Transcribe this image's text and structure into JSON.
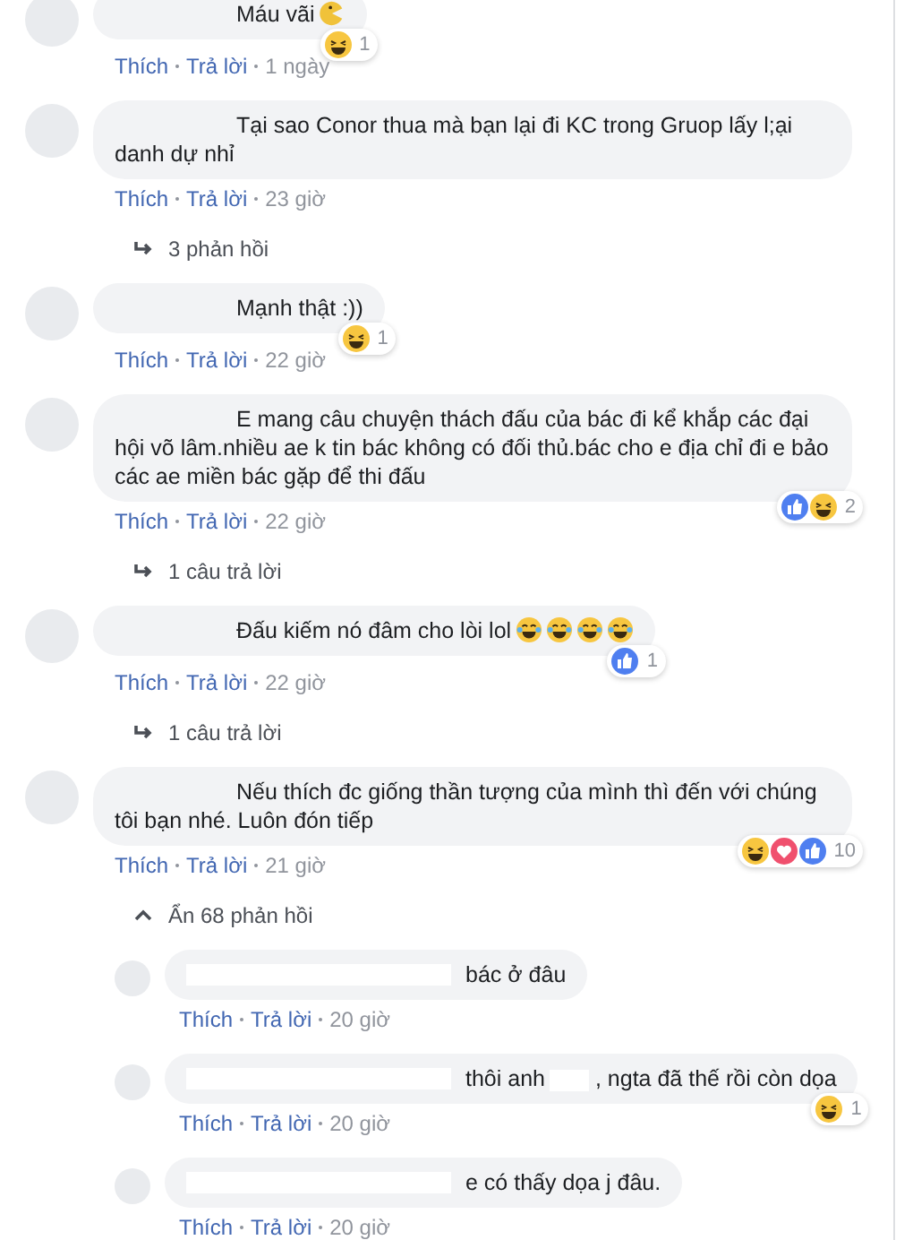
{
  "comments": [
    {
      "text": "Máu vãi",
      "emoji": [
        {
          "kind": "pacman"
        }
      ],
      "reactions": [
        {
          "kind": "haha"
        }
      ],
      "reaction_count": "1",
      "like_label": "Thích",
      "reply_label": "Trả lời",
      "time": "1 ngày"
    },
    {
      "text": "Tại sao Conor thua mà bạn lại đi KC trong Gruop lấy l;ại danh dự nhỉ",
      "like_label": "Thích",
      "reply_label": "Trả lời",
      "time": "23 giờ",
      "thread": {
        "kind": "collapsed",
        "label": "3 phản hồi"
      }
    },
    {
      "text": "Mạnh thật :))",
      "reactions": [
        {
          "kind": "haha"
        }
      ],
      "reaction_count": "1",
      "like_label": "Thích",
      "reply_label": "Trả lời",
      "time": "22 giờ"
    },
    {
      "text": "E mang câu chuyện thách đấu của bác đi kể khắp các đại hội võ lâm.nhiều ae k tin bác không có đối thủ.bác cho e địa chỉ đi e bảo các ae miền bác gặp để thi đấu",
      "reactions": [
        {
          "kind": "like"
        },
        {
          "kind": "haha"
        }
      ],
      "reaction_count": "2",
      "like_label": "Thích",
      "reply_label": "Trả lời",
      "time": "22 giờ",
      "thread": {
        "kind": "collapsed",
        "label": "1 câu trả lời"
      }
    },
    {
      "text": "Đấu kiếm nó đâm cho lòi lol",
      "emoji": [
        {
          "kind": "tears"
        },
        {
          "kind": "tears"
        },
        {
          "kind": "tears"
        },
        {
          "kind": "tears"
        }
      ],
      "reactions": [
        {
          "kind": "like"
        }
      ],
      "reaction_count": "1",
      "like_label": "Thích",
      "reply_label": "Trả lời",
      "time": "22 giờ",
      "thread": {
        "kind": "collapsed",
        "label": "1 câu trả lời"
      }
    },
    {
      "text": "Nếu thích đc giống thần tượng của mình thì đến với chúng tôi bạn nhé. Luôn đón tiếp",
      "reactions": [
        {
          "kind": "haha"
        },
        {
          "kind": "love"
        },
        {
          "kind": "like"
        }
      ],
      "reaction_count": "10",
      "like_label": "Thích",
      "reply_label": "Trả lời",
      "time": "21 giờ",
      "thread": {
        "kind": "expanded",
        "label": "Ẩn 68 phản hồi"
      },
      "replies": [
        {
          "text": "bác ở đâu",
          "like_label": "Thích",
          "reply_label": "Trả lời",
          "time": "20 giờ"
        },
        {
          "text": ", ngta đã thế rồi còn dọa",
          "prefix": "thôi anh",
          "reactions": [
            {
              "kind": "haha"
            }
          ],
          "reaction_count": "1",
          "like_label": "Thích",
          "reply_label": "Trả lời",
          "time": "20 giờ"
        },
        {
          "text": "e có thấy dọa j đâu.",
          "like_label": "Thích",
          "reply_label": "Trả lời",
          "time": "20 giờ"
        }
      ]
    }
  ]
}
